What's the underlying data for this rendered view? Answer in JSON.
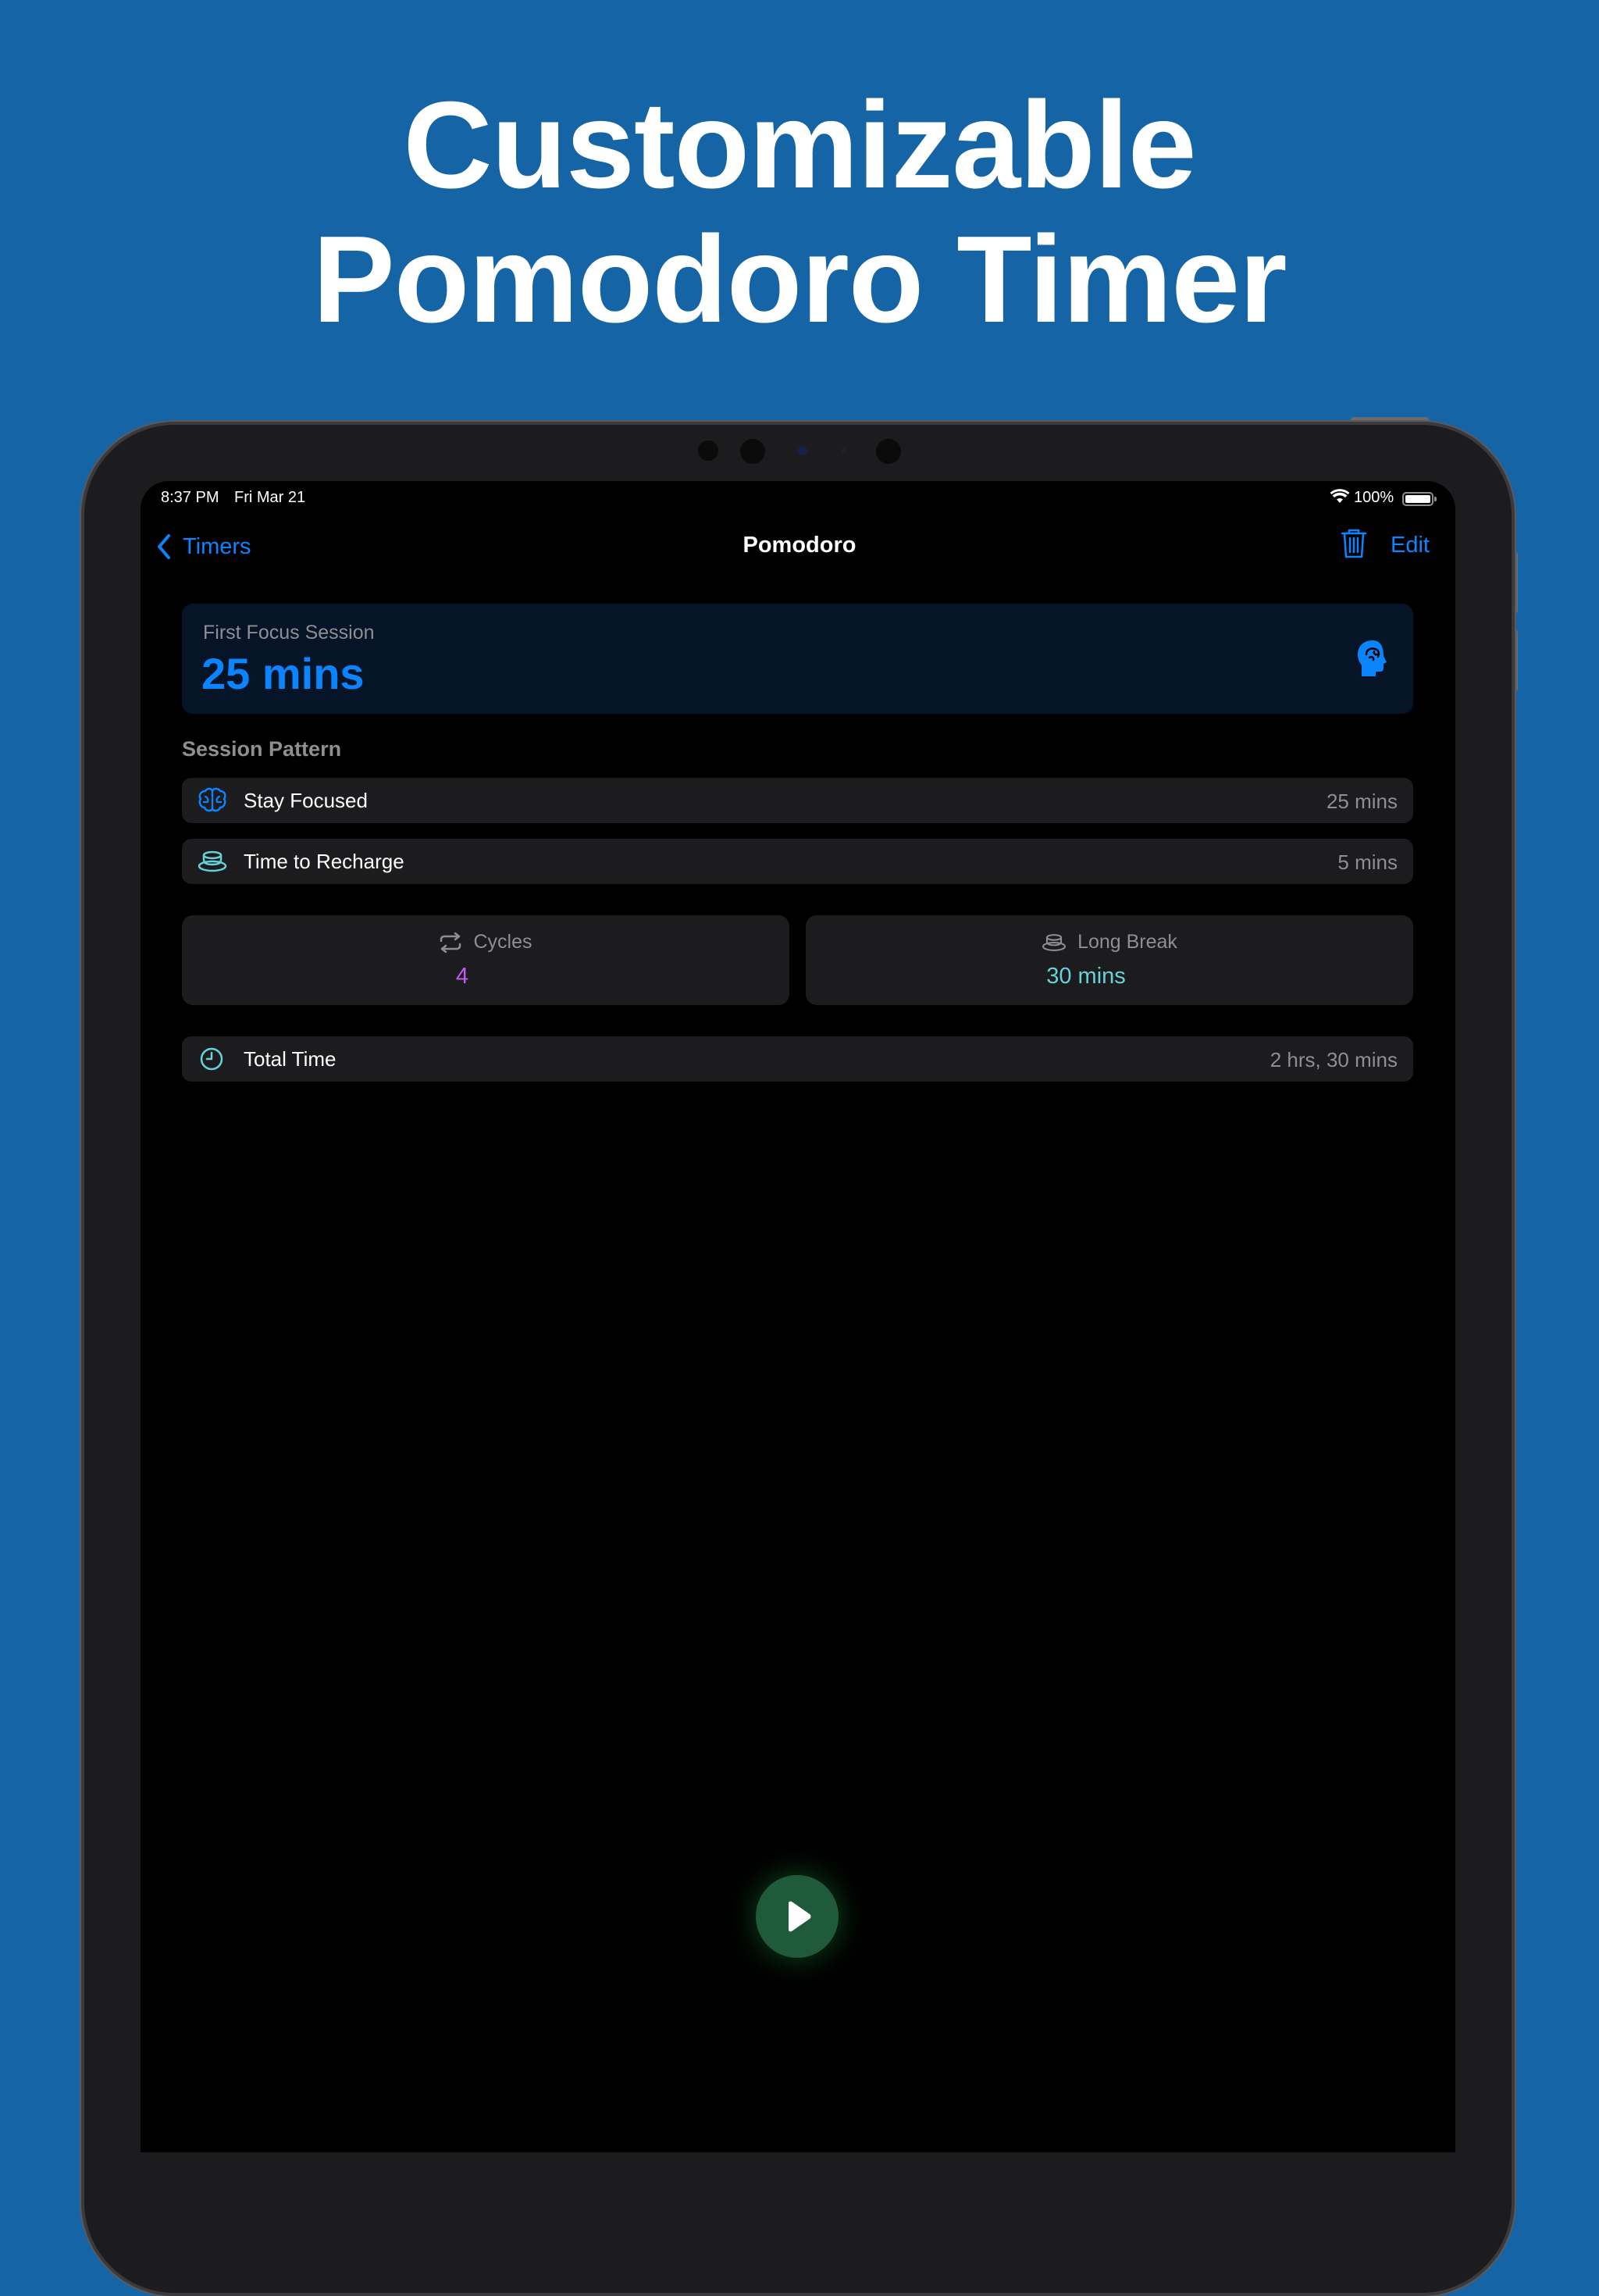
{
  "headline": {
    "line1": "Customizable",
    "line2": "Pomodoro Timer"
  },
  "status_bar": {
    "time": "8:37 PM",
    "date": "Fri Mar 21",
    "battery": "100%"
  },
  "nav": {
    "back_label": "Timers",
    "title": "Pomodoro",
    "edit_label": "Edit"
  },
  "focus_card": {
    "label": "First Focus Session",
    "value": "25 mins",
    "icon": "brain-head-icon"
  },
  "session_pattern": {
    "title": "Session Pattern",
    "items": [
      {
        "icon": "brain-icon",
        "label": "Stay Focused",
        "value": "25 mins"
      },
      {
        "icon": "cup-icon",
        "label": "Time to Recharge",
        "value": "5 mins"
      }
    ]
  },
  "tiles": {
    "cycles": {
      "icon": "repeat-icon",
      "label": "Cycles",
      "value": "4"
    },
    "long_break": {
      "icon": "cup-icon",
      "label": "Long Break",
      "value": "30 mins"
    }
  },
  "total": {
    "icon": "clock-icon",
    "label": "Total Time",
    "value": "2 hrs, 30 mins"
  },
  "colors": {
    "background": "#1565a6",
    "accent": "#0a84ff",
    "teal": "#64d2d7",
    "purple": "#bf5af2",
    "play": "#1f5a3a"
  }
}
